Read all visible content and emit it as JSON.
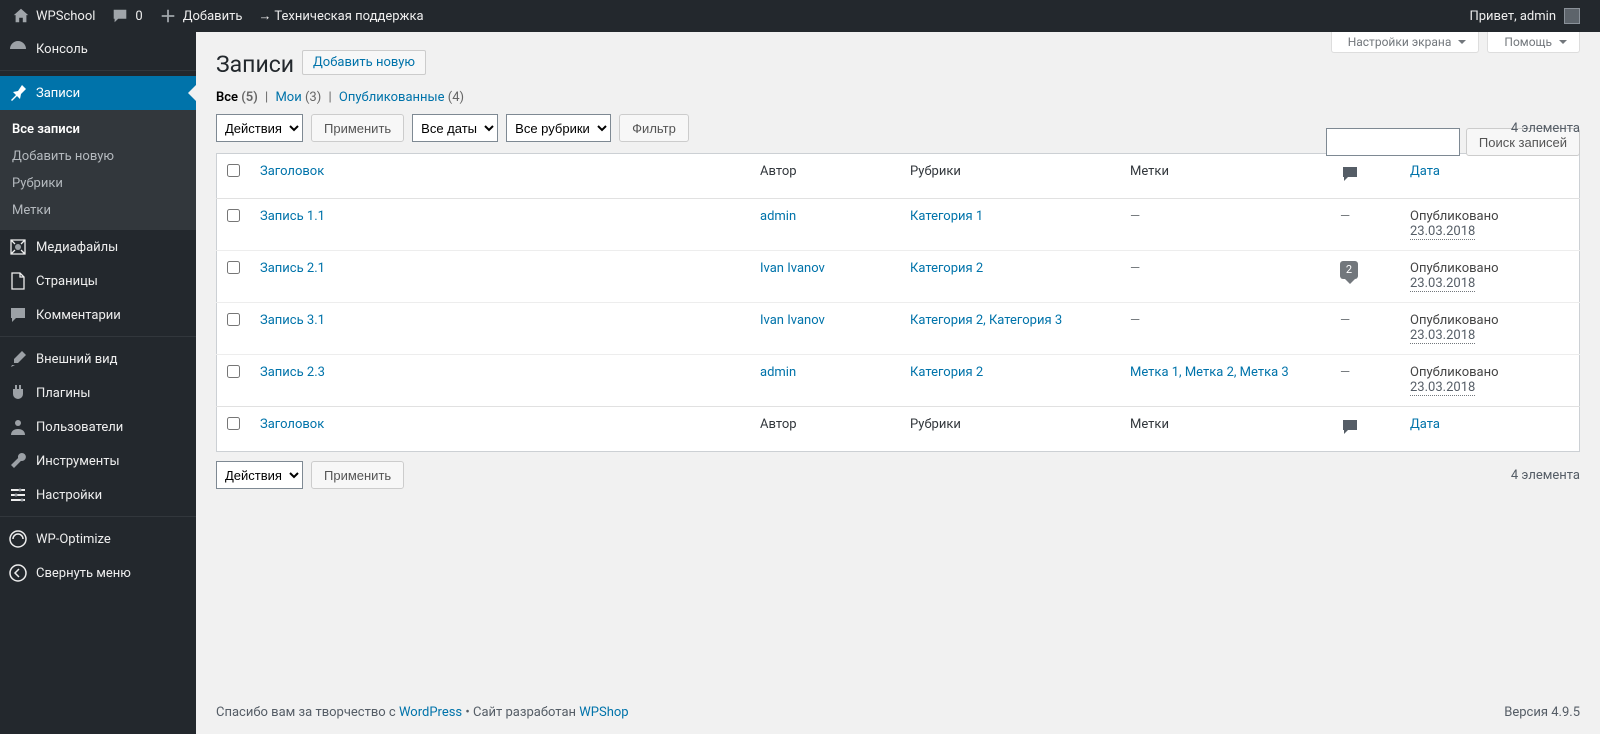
{
  "adminbar": {
    "site_name": "WPSchool",
    "comments_count": "0",
    "add_new": "Добавить",
    "support_link": "→ Техническая поддержка",
    "greeting": "Привет, admin"
  },
  "sidebar": {
    "dashboard": "Консоль",
    "posts": "Записи",
    "posts_sub": {
      "all": "Все записи",
      "add": "Добавить новую",
      "categories": "Рубрики",
      "tags": "Метки"
    },
    "media": "Медиафайлы",
    "pages": "Страницы",
    "comments": "Комментарии",
    "appearance": "Внешний вид",
    "plugins": "Плагины",
    "users": "Пользователи",
    "tools": "Инструменты",
    "settings": "Настройки",
    "wp_optimize": "WP-Optimize",
    "collapse": "Свернуть меню"
  },
  "screen_meta": {
    "options": "Настройки экрана",
    "help": "Помощь"
  },
  "page": {
    "heading": "Записи",
    "add_new": "Добавить новую"
  },
  "filters": {
    "all_label": "Все",
    "all_count": "(5)",
    "mine_label": "Мои",
    "mine_count": "(3)",
    "published_label": "Опубликованные",
    "published_count": "(4)"
  },
  "search": {
    "button": "Поиск записей"
  },
  "bulk": {
    "actions_placeholder": "Действия",
    "apply": "Применить",
    "all_dates": "Все даты",
    "all_categories": "Все рубрики",
    "filter": "Фильтр"
  },
  "count_text": "4 элемента",
  "columns": {
    "title": "Заголовок",
    "author": "Автор",
    "categories": "Рубрики",
    "tags": "Метки",
    "date": "Дата"
  },
  "rows": [
    {
      "title": "Запись 1.1",
      "author": "admin",
      "categories": "Категория 1",
      "tags": "—",
      "comments": "—",
      "status": "Опубликовано",
      "date": "23.03.2018"
    },
    {
      "title": "Запись 2.1",
      "author": "Ivan Ivanov",
      "categories": "Категория 2",
      "tags": "—",
      "comments": "2",
      "status": "Опубликовано",
      "date": "23.03.2018"
    },
    {
      "title": "Запись 3.1",
      "author": "Ivan Ivanov",
      "categories": "Категория 2, Категория 3",
      "tags": "—",
      "comments": "—",
      "status": "Опубликовано",
      "date": "23.03.2018"
    },
    {
      "title": "Запись 2.3",
      "author": "admin",
      "categories": "Категория 2",
      "tags": "Метка 1, Метка 2, Метка 3",
      "comments": "—",
      "status": "Опубликовано",
      "date": "23.03.2018"
    }
  ],
  "footer": {
    "thanks_pre": "Спасибо вам за творчество с ",
    "wordpress": "WordPress",
    "site_by": " • Сайт разработан ",
    "wpshop": "WPShop",
    "version": "Версия 4.9.5"
  }
}
